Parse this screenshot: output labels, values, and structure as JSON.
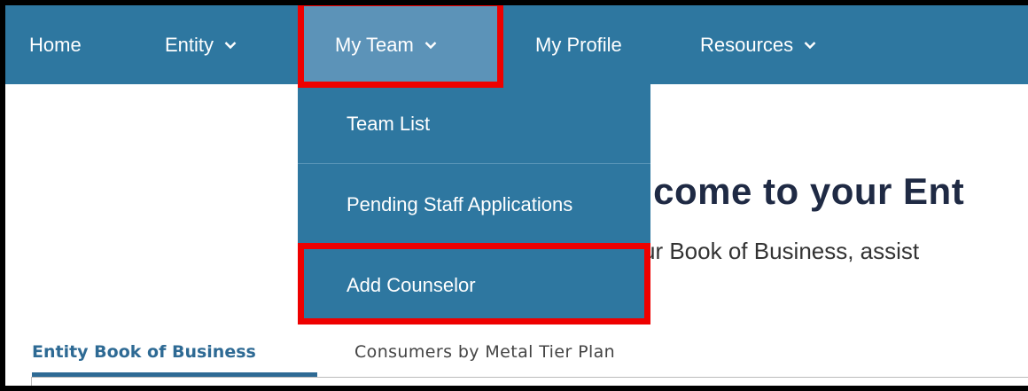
{
  "nav": {
    "home": "Home",
    "entity": "Entity",
    "my_team": "My Team",
    "my_profile": "My Profile",
    "resources": "Resources"
  },
  "dropdown": {
    "items": [
      "Team List",
      "Pending Staff Applications",
      "Add Counselor"
    ]
  },
  "hero": {
    "title": "lcome to your Ent",
    "subtitle": "ur Book of Business, assist"
  },
  "tabs": [
    "Entity Book of Business",
    "Consumers by Metal Tier Plan"
  ],
  "colors": {
    "nav_bg": "#2e77a0",
    "nav_active": "#5c93b8",
    "highlight": "#ee0000",
    "tab_active": "#2e6a94"
  },
  "icons": {
    "chevron": "chevron-down-icon"
  }
}
